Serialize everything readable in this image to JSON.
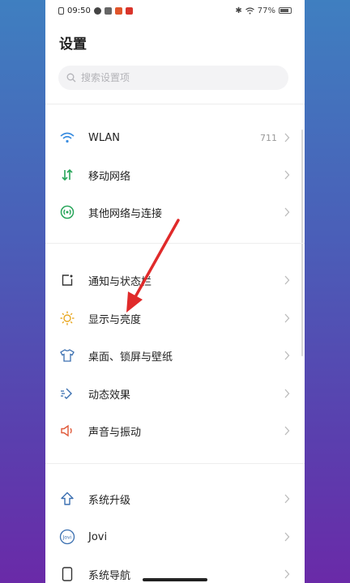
{
  "status_bar": {
    "time": "09:50",
    "battery": "77%"
  },
  "page": {
    "title": "设置"
  },
  "search": {
    "placeholder": "搜索设置项"
  },
  "groups": [
    {
      "items": [
        {
          "label": "WLAN",
          "value": "711",
          "icon": "wifi-icon",
          "color": "#3a8de0"
        },
        {
          "label": "移动网络",
          "icon": "mobile-data-icon",
          "color": "#27a559"
        },
        {
          "label": "其他网络与连接",
          "icon": "connection-icon",
          "color": "#27a559"
        }
      ]
    },
    {
      "items": [
        {
          "label": "通知与状态栏",
          "icon": "notification-icon",
          "color": "#333333"
        },
        {
          "label": "显示与亮度",
          "icon": "sun-icon",
          "color": "#e8a720"
        },
        {
          "label": "桌面、锁屏与壁纸",
          "icon": "shirt-icon",
          "color": "#3a6fb0"
        },
        {
          "label": "动态效果",
          "icon": "effects-icon",
          "color": "#3a6fb0"
        },
        {
          "label": "声音与振动",
          "icon": "speaker-icon",
          "color": "#e05a3a"
        }
      ]
    },
    {
      "items": [
        {
          "label": "系统升级",
          "icon": "upgrade-icon",
          "color": "#3a6fb0"
        },
        {
          "label": "Jovi",
          "icon": "jovi-icon",
          "color": "#3a6fb0"
        },
        {
          "label": "系统导航",
          "icon": "phone-icon",
          "color": "#333333"
        }
      ]
    }
  ],
  "colors": {
    "annotation_arrow": "#e02a2a"
  }
}
